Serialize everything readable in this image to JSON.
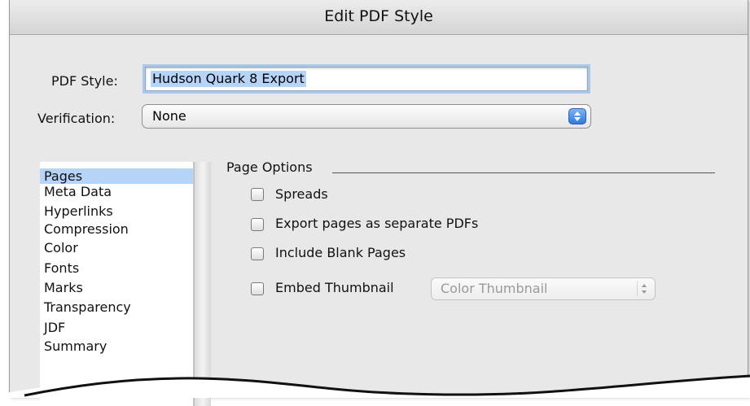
{
  "window": {
    "title": "Edit PDF Style"
  },
  "form": {
    "pdf_style_label": "PDF Style:",
    "pdf_style_value": "Hudson Quark 8 Export",
    "verification_label": "Verification:",
    "verification_value": "None"
  },
  "sidebar": {
    "items": [
      {
        "label": "Pages",
        "selected": true
      },
      {
        "label": "Meta Data",
        "selected": false
      },
      {
        "label": "Hyperlinks",
        "selected": false
      },
      {
        "label": "Compression",
        "selected": false
      },
      {
        "label": "Color",
        "selected": false
      },
      {
        "label": "Fonts",
        "selected": false
      },
      {
        "label": "Marks",
        "selected": false
      },
      {
        "label": "Transparency",
        "selected": false
      },
      {
        "label": "JDF",
        "selected": false
      },
      {
        "label": "Summary",
        "selected": false
      }
    ]
  },
  "page_options": {
    "title": "Page Options",
    "options": [
      {
        "label": "Spreads",
        "checked": false
      },
      {
        "label": "Export pages as separate PDFs",
        "checked": false
      },
      {
        "label": "Include Blank Pages",
        "checked": false
      },
      {
        "label": "Embed Thumbnail",
        "checked": false
      }
    ],
    "thumbnail_select_value": "Color Thumbnail",
    "thumbnail_select_enabled": false
  },
  "colors": {
    "selection": "#b5d4f8",
    "focus_ring": "#a9c8ec",
    "accent_stepper": "#2f7ae0"
  }
}
